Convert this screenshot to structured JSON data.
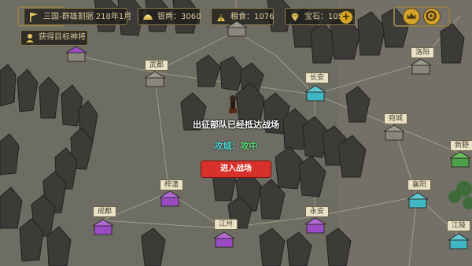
{
  "topbar": {
    "scenario": "三国-群雄割据 218年1月",
    "silver_label": "银两：3060",
    "grain_label": "粮食：1076",
    "gem_label": "宝石：105",
    "plus_label": "+"
  },
  "quest": {
    "label": "获得目标神将"
  },
  "cities": [
    {
      "id": "wudu",
      "name": "武都",
      "style": "neutral"
    },
    {
      "id": "changan",
      "name": "长安",
      "style": "cyan"
    },
    {
      "id": "luoyang",
      "name": "洛阳",
      "style": "neutral"
    },
    {
      "id": "wancheng",
      "name": "宛城",
      "style": "neutral"
    },
    {
      "id": "xinye",
      "name": "新野",
      "style": "green"
    },
    {
      "id": "xiangyang",
      "name": "襄阳",
      "style": "cyan"
    },
    {
      "id": "zitong",
      "name": "梓潼",
      "style": "purple"
    },
    {
      "id": "chengdu",
      "name": "成都",
      "style": "purple"
    },
    {
      "id": "yongan",
      "name": "永安",
      "style": "purple"
    },
    {
      "id": "jiangzhou",
      "name": "江州",
      "style": "purple"
    },
    {
      "id": "jiangling",
      "name": "江陵",
      "style": "cyan"
    }
  ],
  "dialog": {
    "message": "出征部队已经抵达战场",
    "status_key": "攻城：",
    "status_value": "攻中",
    "enter_label": "进入战场"
  },
  "colors": {
    "ground": "#6e6d63",
    "rock": "#3c3b38",
    "enter_button": "#d8302a",
    "gold": "#d3a22a",
    "city_cyan": "#3fb7c4",
    "city_purple": "#9b4bc4",
    "city_green": "#4aa14a"
  }
}
